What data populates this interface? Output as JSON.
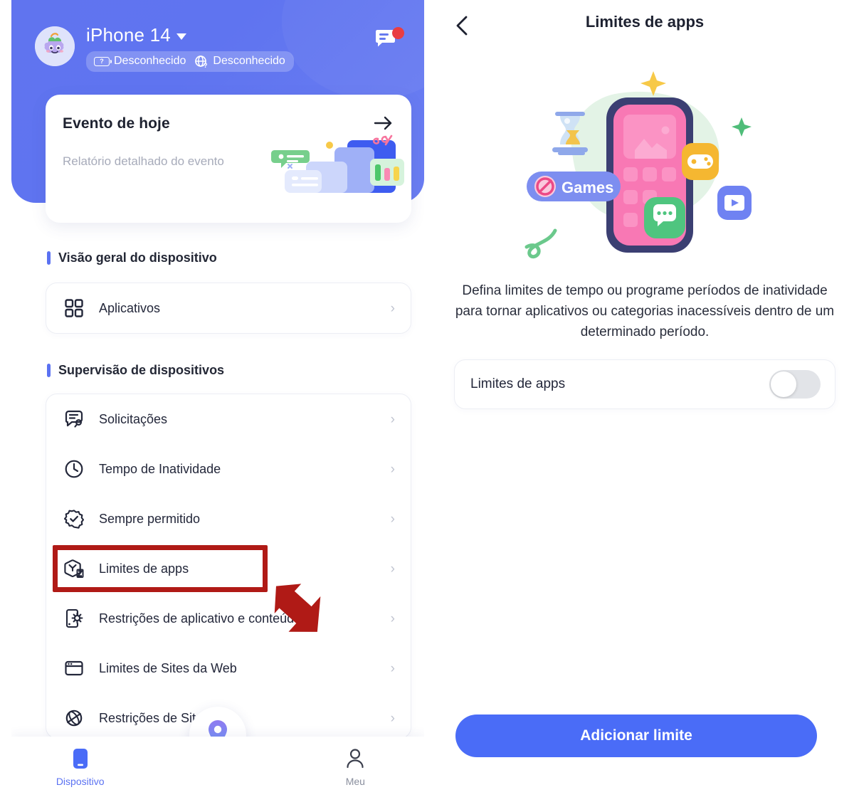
{
  "left": {
    "device": {
      "name": "iPhone 14",
      "caret_icon": "chevron-down-icon",
      "avatar_icon": "grape-character-avatar",
      "badges": [
        {
          "icon": "battery-unknown-icon",
          "label": "Desconhecido"
        },
        {
          "icon": "network-unknown-icon",
          "label": "Desconhecido"
        }
      ],
      "message_icon": "message-icon",
      "message_has_unread": true
    },
    "event_card": {
      "title": "Evento de hoje",
      "subtitle": "Relatório detalhado do evento",
      "arrow_icon": "arrow-right-icon"
    },
    "sections": [
      {
        "title": "Visão geral do dispositivo",
        "items": [
          {
            "icon": "grid-apps-icon",
            "label": "Aplicativos",
            "chevron": "›"
          }
        ]
      },
      {
        "title": "Supervisão de dispositivos",
        "items": [
          {
            "icon": "requests-icon",
            "label": "Solicitações",
            "chevron": "›"
          },
          {
            "icon": "clock-icon",
            "label": "Tempo de Inatividade",
            "chevron": "›"
          },
          {
            "icon": "badge-check-icon",
            "label": "Sempre permitido",
            "chevron": "›"
          },
          {
            "icon": "app-limit-icon",
            "label": "Limites de apps",
            "chevron": "›"
          },
          {
            "icon": "device-settings-icon",
            "label": "Restrições de aplicativo e conteúdo",
            "chevron": "›"
          },
          {
            "icon": "browser-icon",
            "label": "Limites de Sites da Web",
            "chevron": "›"
          },
          {
            "icon": "no-globe-icon",
            "label": "Restrições de Sites",
            "chevron": "›"
          }
        ]
      }
    ],
    "fab": {
      "icon": "location-pin-icon"
    },
    "bottom_nav": [
      {
        "icon": "device-icon",
        "label": "Dispositivo",
        "active": true
      },
      {
        "icon": "person-icon",
        "label": "Meu",
        "active": false
      }
    ],
    "annotation": {
      "highlight_target": "Limites de apps",
      "highlight_color": "#b01a16",
      "arrow_icon": "pointer-arrow-annotation"
    }
  },
  "right": {
    "back_icon": "chevron-left-icon",
    "title": "Limites de apps",
    "illustration": {
      "name": "app-limits-illustration",
      "badge_label": "Games",
      "badge_icon": "no-entry-icon",
      "tiles": [
        "game-controller-icon",
        "chat-bubble-icon",
        "video-play-icon"
      ],
      "extras": [
        "hourglass-icon",
        "yellow-star",
        "green-star",
        "green-squiggle"
      ]
    },
    "description": "Defina limites de tempo ou programe períodos de inatividade para tornar aplicativos ou categorias inacessíveis dentro de um determinado período.",
    "toggle_row": {
      "label": "Limites de apps",
      "value": "off"
    },
    "cta": {
      "label": "Adicionar limite"
    }
  },
  "colors": {
    "brand_blue": "#5b72f2",
    "cta_blue": "#4a6cf7",
    "hero_blue": "#6074ef",
    "annotation_red": "#b01a16",
    "muted_text": "#a7abba"
  }
}
